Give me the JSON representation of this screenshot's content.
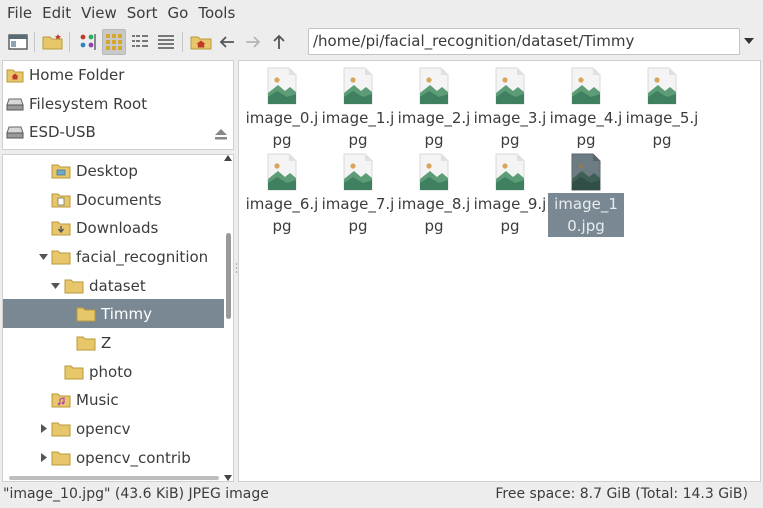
{
  "menu": [
    "File",
    "Edit",
    "View",
    "Sort",
    "Go",
    "Tools"
  ],
  "path": "/home/pi/facial_recognition/dataset/Timmy",
  "places": [
    {
      "label": "Home Folder",
      "icon": "home-folder-icon"
    },
    {
      "label": "Filesystem Root",
      "icon": "drive-icon"
    },
    {
      "label": "ESD-USB",
      "icon": "usb-drive-icon"
    }
  ],
  "tree": [
    {
      "label": "Desktop",
      "icon": "desktop-folder-icon",
      "expander": ""
    },
    {
      "label": "Documents",
      "icon": "documents-folder-icon",
      "expander": ""
    },
    {
      "label": "Downloads",
      "icon": "downloads-folder-icon",
      "expander": ""
    },
    {
      "label": "facial_recognition",
      "icon": "folder-icon",
      "expander": "expanded"
    },
    {
      "label": "dataset",
      "icon": "folder-icon",
      "expander": "expanded"
    },
    {
      "label": "Timmy",
      "icon": "folder-icon",
      "expander": "",
      "selected": true
    },
    {
      "label": "Z",
      "icon": "folder-icon",
      "expander": ""
    },
    {
      "label": "photo",
      "icon": "folder-icon",
      "expander": ""
    },
    {
      "label": "Music",
      "icon": "music-folder-icon",
      "expander": ""
    },
    {
      "label": "opencv",
      "icon": "folder-icon",
      "expander": "collapsed"
    },
    {
      "label": "opencv_contrib",
      "icon": "folder-icon",
      "expander": "collapsed"
    }
  ],
  "files": [
    {
      "name": "image_0.jpg"
    },
    {
      "name": "image_1.jpg"
    },
    {
      "name": "image_2.jpg"
    },
    {
      "name": "image_3.jpg"
    },
    {
      "name": "image_4.jpg"
    },
    {
      "name": "image_5.jpg"
    },
    {
      "name": "image_6.jpg"
    },
    {
      "name": "image_7.jpg"
    },
    {
      "name": "image_8.jpg"
    },
    {
      "name": "image_9.jpg"
    },
    {
      "name": "image_10.jpg",
      "selected": true
    }
  ],
  "status": {
    "left": "\"image_10.jpg\" (43.6 KiB) JPEG image",
    "right": "Free space: 8.7 GiB (Total: 14.3 GiB)"
  },
  "colors": {
    "selection": "#798893",
    "folder": "#e8c76a",
    "image_green": "#4f9a6f"
  }
}
